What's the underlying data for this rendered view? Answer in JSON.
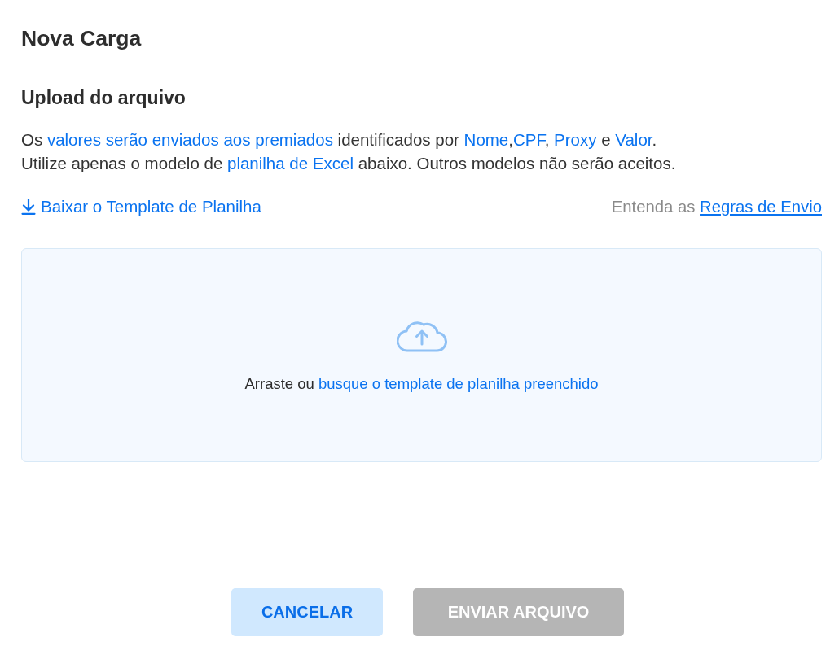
{
  "title": "Nova Carga",
  "section": {
    "title": "Upload do arquivo",
    "lines": [
      [
        {
          "text": "Os ",
          "highlight": false
        },
        {
          "text": "valores serão enviados aos premiados",
          "highlight": true
        },
        {
          "text": " identificados por ",
          "highlight": false
        },
        {
          "text": "Nome",
          "highlight": true
        },
        {
          "text": ",",
          "highlight": false
        },
        {
          "text": "CPF",
          "highlight": true
        },
        {
          "text": ", ",
          "highlight": false
        },
        {
          "text": "Proxy",
          "highlight": true
        },
        {
          "text": " e ",
          "highlight": false
        },
        {
          "text": "Valor",
          "highlight": true
        },
        {
          "text": ".",
          "highlight": false
        }
      ],
      [
        {
          "text": "Utilize apenas o modelo de ",
          "highlight": false
        },
        {
          "text": "planilha de Excel",
          "highlight": true
        },
        {
          "text": " abaixo. Outros modelos não serão aceitos.",
          "highlight": false
        }
      ]
    ]
  },
  "download_link": {
    "label": "Baixar o Template de Planilha"
  },
  "rules": {
    "prefix": "Entenda as",
    "link": "Regras de Envio"
  },
  "dropzone": {
    "text": "Arraste ou",
    "link": "busque o template de planilha preenchido"
  },
  "buttons": [
    {
      "label": "CANCELAR",
      "kind": "secondary",
      "disabled": false
    },
    {
      "label": "ENVIAR ARQUIVO",
      "kind": "primary",
      "disabled": true
    }
  ]
}
